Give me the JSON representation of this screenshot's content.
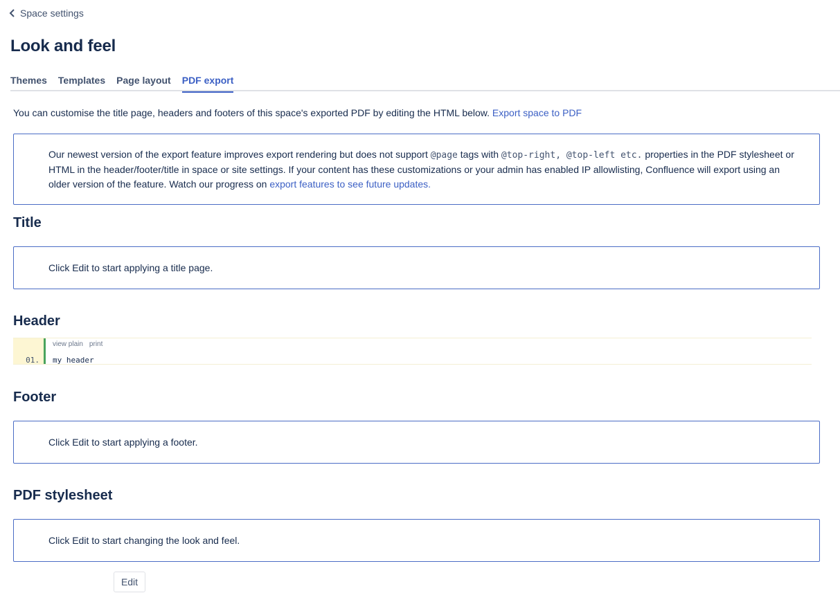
{
  "nav": {
    "back_icon": "chevron-left-icon",
    "back_label": "Space settings"
  },
  "page": {
    "title": "Look and feel"
  },
  "tabs": [
    {
      "label": "Themes",
      "active": false
    },
    {
      "label": "Templates",
      "active": false
    },
    {
      "label": "Page layout",
      "active": false
    },
    {
      "label": "PDF export",
      "active": true
    }
  ],
  "intro": {
    "text": "You can customise the title page, headers and footers of this space's exported PDF by editing the HTML below.",
    "link_label": "Export space to PDF"
  },
  "notice": {
    "text_before_code": "Our newest version of the export feature improves export rendering but does not support",
    "code_1": "@page",
    "text_mid": "tags with",
    "code_2": "@top-right, @top-left etc.",
    "text_after_code": "properties in the PDF stylesheet or HTML in the header/footer/title in space or site settings. If your content has these customizations or your admin has enabled IP allowlisting, Confluence will export using an older version of the feature. Watch our progress on",
    "link_label": "export features to see future updates."
  },
  "sections": {
    "title": {
      "heading": "Title",
      "placeholder": "Click Edit to start applying a title page."
    },
    "header": {
      "heading": "Header",
      "code": {
        "toolbar": [
          "view plain",
          "print"
        ],
        "line_number": "01.",
        "line_text": "my header"
      }
    },
    "footer": {
      "heading": "Footer",
      "placeholder": "Click Edit to start applying a footer."
    },
    "stylesheet": {
      "heading": "PDF stylesheet",
      "placeholder": "Click Edit to start changing the look and feel."
    }
  },
  "actions": {
    "edit_label": "Edit"
  },
  "colors": {
    "accent": "#3b5fc4",
    "text": "#172b4d",
    "box_border": "#4a6cc5",
    "code_gutter": "#fdf6d3",
    "code_bar": "#4aa45d"
  }
}
